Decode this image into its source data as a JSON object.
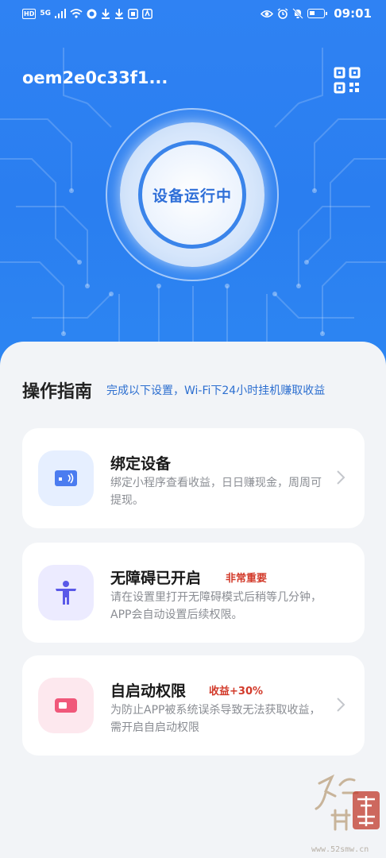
{
  "status_bar": {
    "left_icons": [
      "HD",
      "5G",
      "signal",
      "wifi",
      "app-badge",
      "download",
      "download",
      "app-badge",
      "app-badge"
    ],
    "time": "09:01"
  },
  "header": {
    "device_id": "oem2e0c33f1..."
  },
  "device_status": {
    "label": "设备运行中"
  },
  "guide": {
    "title": "操作指南",
    "subtitle": "完成以下设置，Wi-Fi下24小时挂机赚取收益"
  },
  "cards": [
    {
      "title": "绑定设备",
      "badge": "",
      "desc": "绑定小程序查看收益，日日赚现金，周周可提现。",
      "icon": "card-icon",
      "icon_bg": "#e6efff",
      "icon_color": "#4b7cf0"
    },
    {
      "title": "无障碍已开启",
      "badge": "非常重要",
      "desc": "请在设置里打开无障碍模式后稍等几分钟，APP会自动设置后续权限。",
      "icon": "accessibility-icon",
      "icon_bg": "#ecebff",
      "icon_color": "#5a59e8"
    },
    {
      "title": "自启动权限",
      "badge": "收益+30%",
      "desc": "为防止APP被系统误杀导致无法获取收益，需开启自启动权限",
      "icon": "toggle-icon",
      "icon_bg": "#fde8ee",
      "icon_color": "#f0587a"
    }
  ],
  "watermark": {
    "site": "www.52smw.cn"
  },
  "colors": {
    "hero_blue": "#2b7ff1",
    "accent_blue": "#2d6fd0",
    "badge_red": "#d23a2a"
  }
}
